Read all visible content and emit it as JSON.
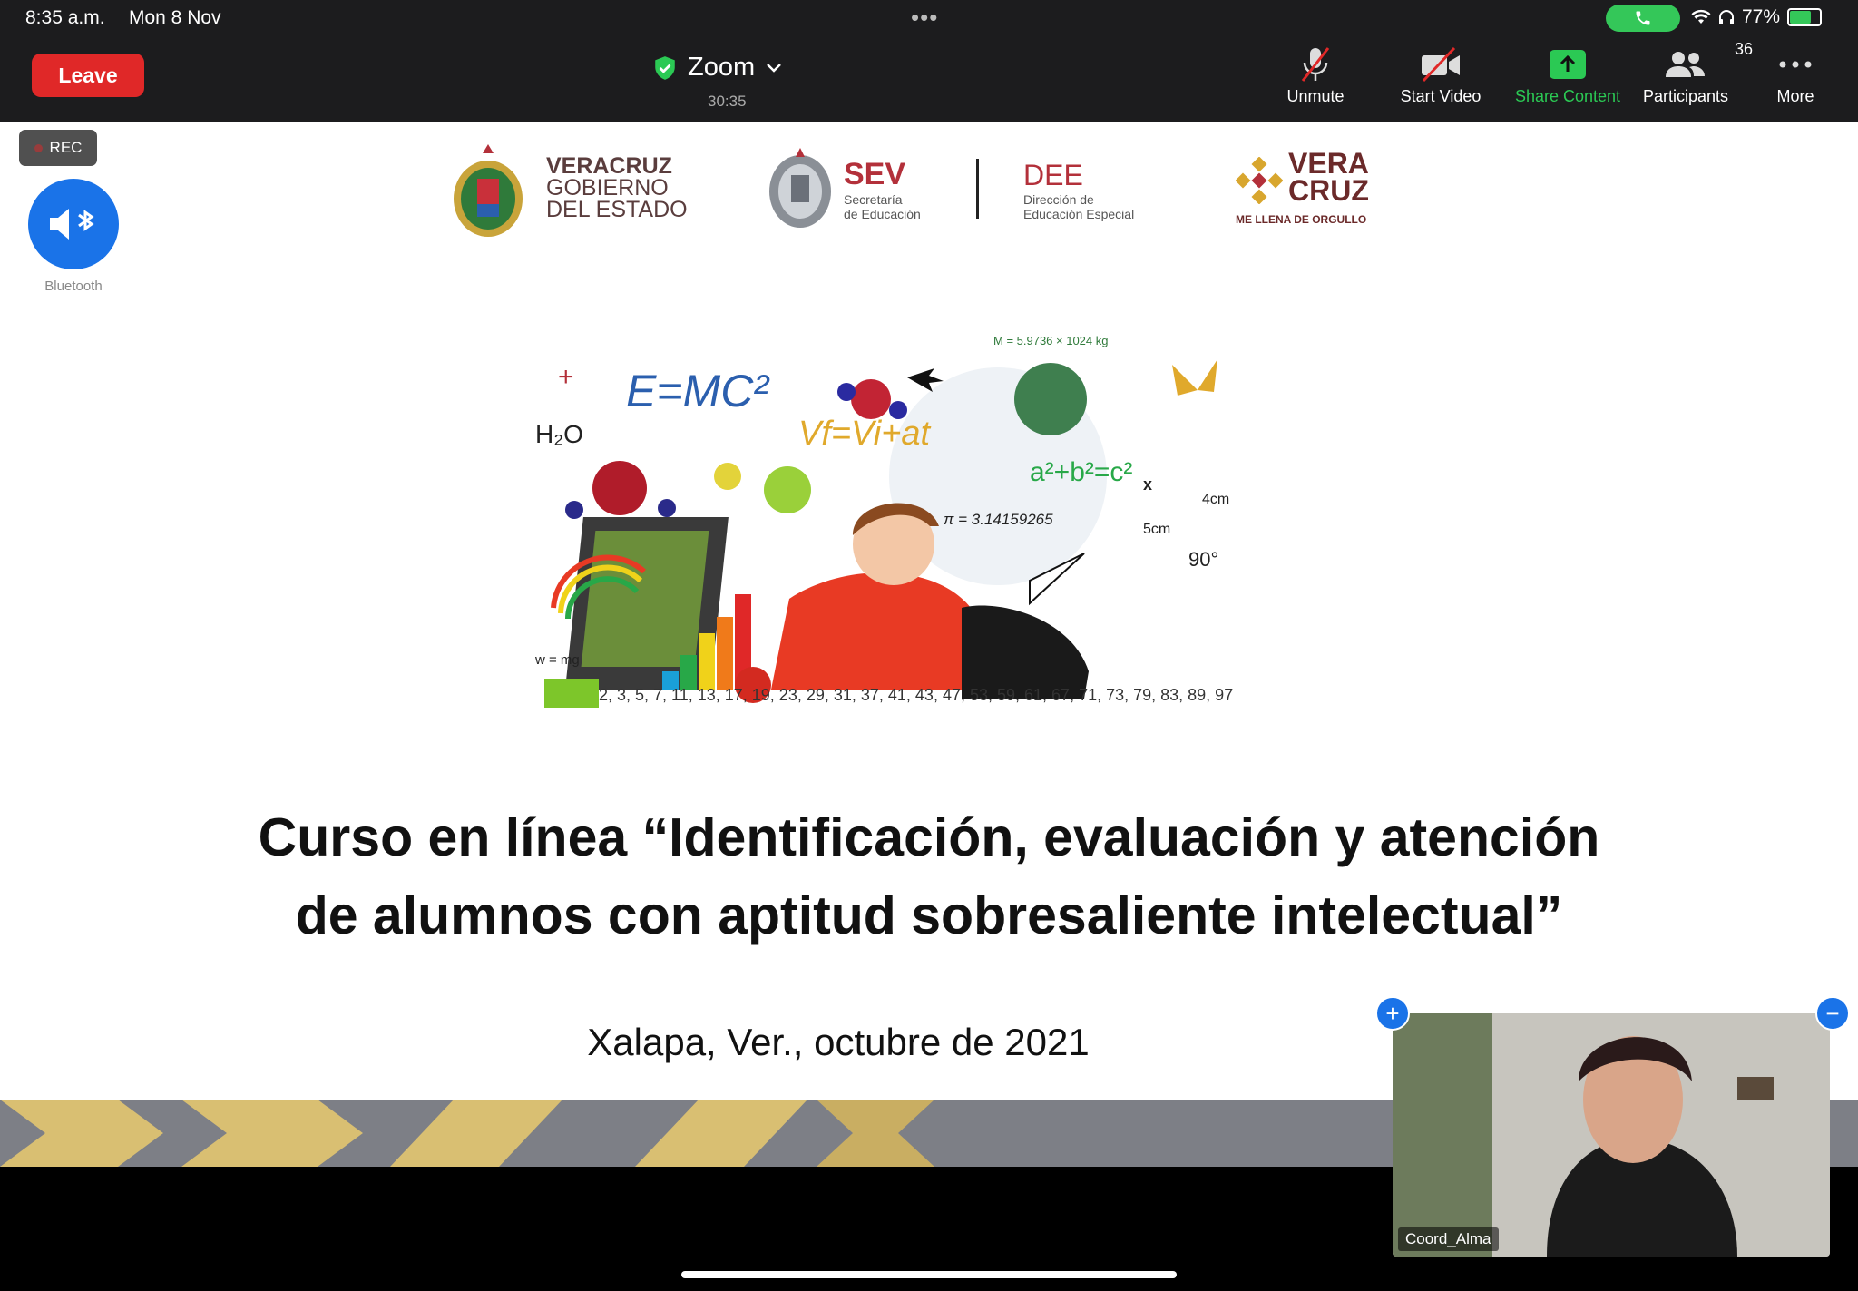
{
  "status_bar": {
    "time": "8:35 a.m.",
    "date": "Mon 8 Nov",
    "battery_percent": "77%",
    "battery_level": 0.77
  },
  "toolbar": {
    "leave_label": "Leave",
    "meeting_title": "Zoom",
    "elapsed": "30:35",
    "unmute_label": "Unmute",
    "start_video_label": "Start Video",
    "share_label": "Share Content",
    "participants_label": "Participants",
    "participants_count": "36",
    "more_label": "More"
  },
  "overlay": {
    "rec_label": "REC",
    "audio_route_label": "Bluetooth"
  },
  "slide": {
    "logos": {
      "veracruz_gob_line1": "VERACRUZ",
      "veracruz_gob_line2": "GOBIERNO",
      "veracruz_gob_line3": "DEL ESTADO",
      "sev_title": "SEV",
      "sev_sub1": "Secretaría",
      "sev_sub2": "de Educación",
      "dee_title": "DEE",
      "dee_sub1": "Dirección de",
      "dee_sub2": "Educación Especial",
      "veracruz_brand_line1": "VERA",
      "veracruz_brand_line2": "CRUZ",
      "veracruz_tagline": "ME LLENA DE ORGULLO"
    },
    "art_text": {
      "emc": "E=MC²",
      "mass": "M = 5.9736 × 1024 kg",
      "water": "H₂O",
      "velocity": "Vf=Vi+at",
      "pythagoras": "a²+b²=c²",
      "pi": "π = 3.14159265",
      "side_4": "4cm",
      "side_5": "5cm",
      "side_x": "x",
      "angle": "90°",
      "weight": "w = mg",
      "primes": "2, 3, 5, 7, 11, 13, 17, 19, 23, 29, 31, 37, 41, 43, 47, 53, 59, 61, 67, 71, 73, 79, 83, 89, 97."
    },
    "title_line1": "Curso en línea “Identificación, evaluación y atención",
    "title_line2": "de alumnos con aptitud sobresaliente intelectual”",
    "subtitle": "Xalapa, Ver., octubre de 2021"
  },
  "video_tile": {
    "participant_name": "Coord_Alma"
  },
  "colors": {
    "leave_red": "#e02828",
    "share_green": "#2bc954",
    "zoom_blue": "#1a73e8",
    "stripe_gold": "#d9bf72"
  },
  "icons": [
    "shield-check-icon",
    "chevron-down-icon",
    "microphone-muted-icon",
    "video-off-icon",
    "share-arrow-icon",
    "participants-icon",
    "more-dots-icon",
    "bluetooth-speaker-icon",
    "wifi-icon",
    "headphones-icon",
    "battery-icon",
    "phone-icon"
  ]
}
